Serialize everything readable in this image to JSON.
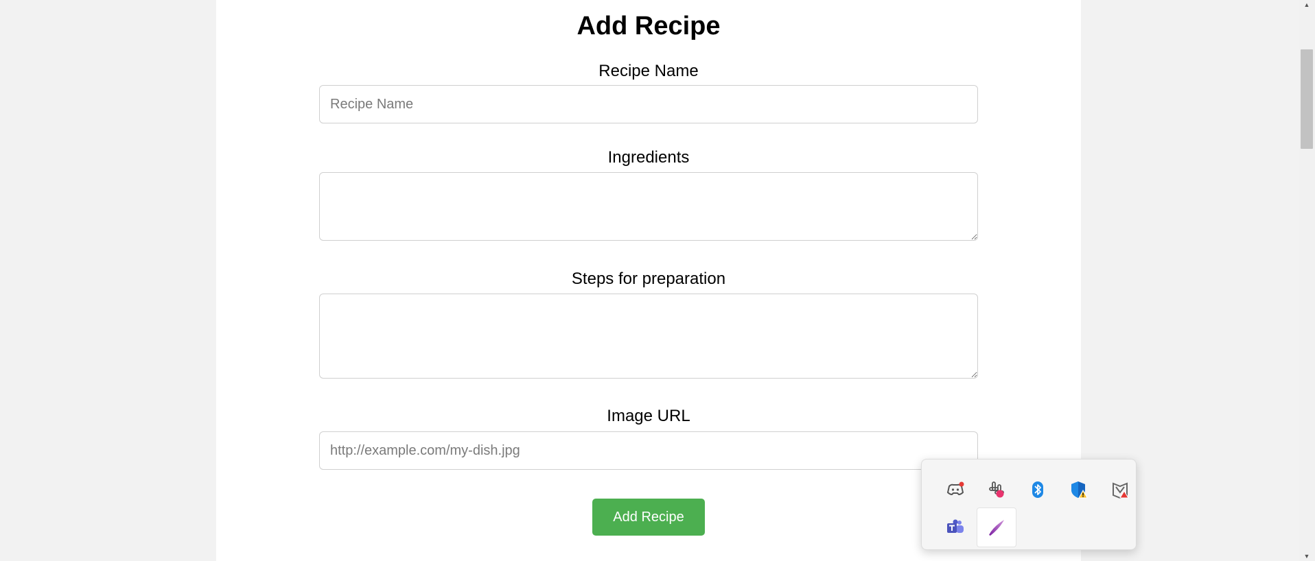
{
  "form": {
    "title": "Add Recipe",
    "name_label": "Recipe Name",
    "name_placeholder": "Recipe Name",
    "ingredients_label": "Ingredients",
    "steps_label": "Steps for preparation",
    "image_label": "Image URL",
    "image_placeholder": "http://example.com/my-dish.jpg",
    "submit_label": "Add Recipe"
  },
  "colors": {
    "submit_button": "#4caf50",
    "page_background": "#f2f2f2",
    "card_background": "#ffffff"
  },
  "tray": {
    "icons": [
      {
        "name": "discord-icon"
      },
      {
        "name": "slack-icon"
      },
      {
        "name": "bluetooth-icon"
      },
      {
        "name": "windows-security-icon"
      },
      {
        "name": "mcafee-icon"
      },
      {
        "name": "teams-icon"
      },
      {
        "name": "pen-icon"
      }
    ]
  }
}
